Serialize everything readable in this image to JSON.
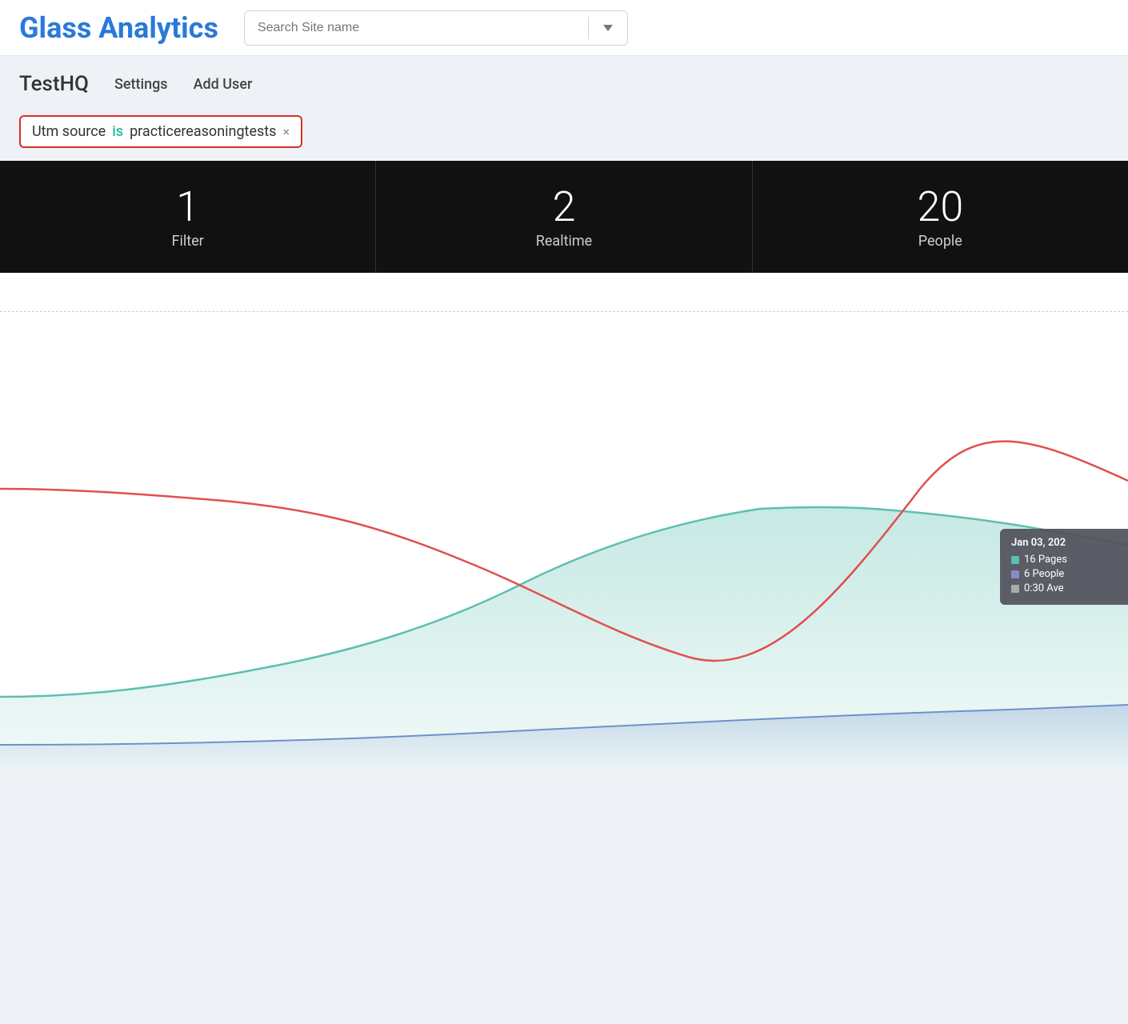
{
  "header": {
    "logo": "Glass Analytics",
    "search": {
      "placeholder": "Search Site name"
    }
  },
  "sub_header": {
    "site_name": "TestHQ",
    "nav": [
      {
        "label": "Settings"
      },
      {
        "label": "Add User"
      }
    ]
  },
  "filter": {
    "label": "Utm source",
    "operator": "is",
    "value": "practicereasoningtests",
    "close_icon": "×"
  },
  "stats": [
    {
      "number": "1",
      "label": "Filter"
    },
    {
      "number": "2",
      "label": "Realtime"
    },
    {
      "number": "20",
      "label": "People"
    }
  ],
  "tooltip": {
    "date": "Jan 03, 202",
    "rows": [
      {
        "color": "teal",
        "text": "16 Pages"
      },
      {
        "color": "purple",
        "text": "6 People"
      },
      {
        "color": "gray",
        "text": "0:30 Ave"
      }
    ]
  },
  "chart": {
    "dashed_line": true
  }
}
